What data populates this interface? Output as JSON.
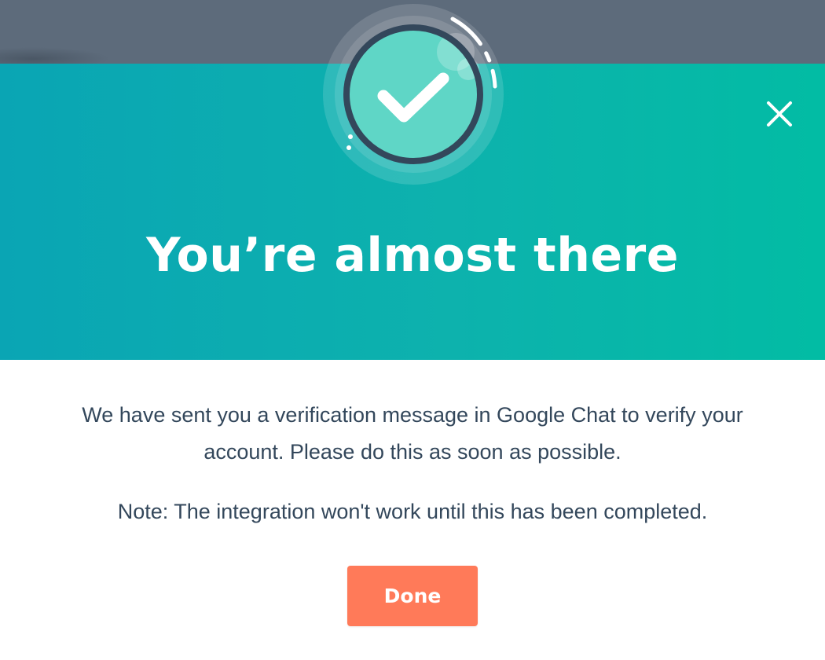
{
  "dialog": {
    "title": "You’re almost there",
    "message": "We have sent you a verification message in Google Chat to verify your account. Please do this as soon as possible.",
    "note": "Note: The integration won't work until this has been completed.",
    "done_label": "Done",
    "close_icon": "close-icon",
    "badge_icon": "checkmark-icon"
  },
  "colors": {
    "overlay": "#5d6b7b",
    "header_start": "#0aa5b4",
    "header_end": "#02bca4",
    "badge_fill": "#5fd6c6",
    "badge_ring": "#33475b",
    "text": "#33475b",
    "button": "#ff7a59"
  }
}
